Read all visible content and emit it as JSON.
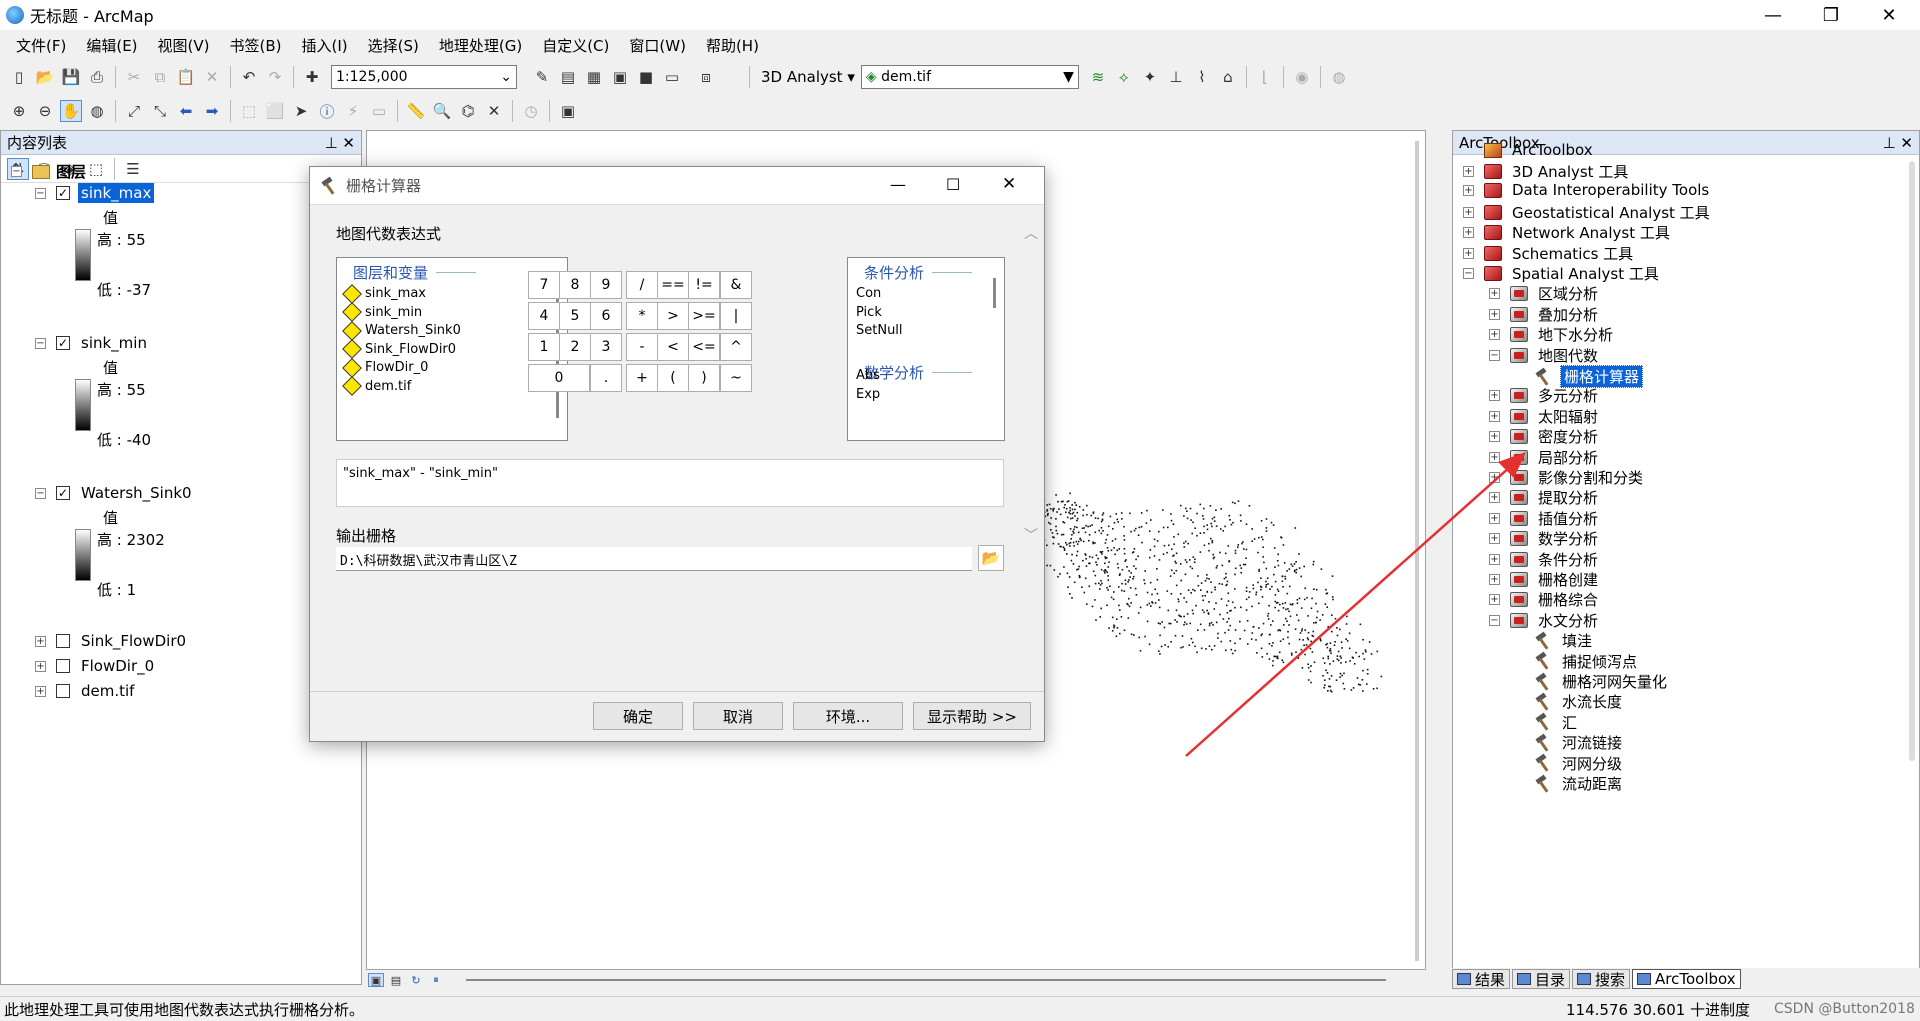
{
  "window": {
    "title": "无标题 - ArcMap"
  },
  "menu": [
    "文件(F)",
    "编辑(E)",
    "视图(V)",
    "书签(B)",
    "插入(I)",
    "选择(S)",
    "地理处理(G)",
    "自定义(C)",
    "窗口(W)",
    "帮助(H)"
  ],
  "toolbar": {
    "scale": "1:125,000",
    "analyst": "3D Analyst",
    "layer": "dem.tif"
  },
  "toc": {
    "title": "内容列表",
    "root": "图层",
    "value_label": "值",
    "layers": [
      {
        "name": "sink_max",
        "checked": true,
        "high": "高 : 55",
        "low": "低 : -37"
      },
      {
        "name": "sink_min",
        "checked": true,
        "high": "高 : 55",
        "low": "低 : -40"
      },
      {
        "name": "Watersh_Sink0",
        "checked": true,
        "high": "高 : 2302",
        "low": "低 : 1"
      },
      {
        "name": "Sink_FlowDir0",
        "checked": false
      },
      {
        "name": "FlowDir_0",
        "checked": false
      },
      {
        "name": "dem.tif",
        "checked": false
      }
    ]
  },
  "toolbox": {
    "title": "ArcToolbox",
    "root": "ArcToolbox",
    "toolsets": [
      "3D Analyst 工具",
      "Data Interoperability Tools",
      "Geostatistical Analyst 工具",
      "Network Analyst 工具",
      "Schematics 工具",
      "Spatial Analyst 工具"
    ],
    "spatial_sets": [
      "区域分析",
      "叠加分析",
      "地下水分析",
      "地图代数"
    ],
    "selected_tool": "栅格计算器",
    "spatial_sets_after": [
      "多元分析",
      "太阳辐射",
      "密度分析",
      "局部分析",
      "影像分割和分类",
      "提取分析",
      "插值分析",
      "数学分析",
      "条件分析",
      "栅格创建",
      "栅格综合",
      "水文分析"
    ],
    "hydro_tools": [
      "填洼",
      "捕捉倾泻点",
      "栅格河网矢量化",
      "水流长度",
      "汇",
      "河流链接",
      "河网分级",
      "流动距离"
    ],
    "tabs": [
      "结果",
      "目录",
      "搜索",
      "ArcToolbox"
    ]
  },
  "dialog": {
    "title": "栅格计算器",
    "section": "地图代数表达式",
    "layers_header": "图层和变量",
    "layers": [
      "sink_max",
      "sink_min",
      "Watersh_Sink0",
      "Sink_FlowDir0",
      "FlowDir_0",
      "dem.tif"
    ],
    "keys": [
      "7",
      "8",
      "9",
      "/",
      "==",
      "!=",
      "&",
      "4",
      "5",
      "6",
      "*",
      ">",
      ">=",
      "|",
      "1",
      "2",
      "3",
      "-",
      "<",
      "<=",
      "^",
      "0",
      ".",
      "+",
      "(",
      ")",
      "~"
    ],
    "cond_header": "条件分析",
    "cond_items": [
      "Con",
      "Pick",
      "SetNull"
    ],
    "math_header": "数学分析",
    "math_items": [
      "Abs",
      "Exp"
    ],
    "expression": "\"sink_max\" - \"sink_min\"",
    "output_label": "输出栅格",
    "output_path": "D:\\科研数据\\武汉市青山区\\Z",
    "buttons": {
      "ok": "确定",
      "cancel": "取消",
      "env": "环境...",
      "help": "显示帮助 >>"
    }
  },
  "status": {
    "message": "此地理处理工具可使用地图代数表达式执行栅格分析。",
    "coords": "114.576  30.601 十进制度",
    "watermark": "CSDN @Button2018"
  },
  "colors": {
    "selection": "#0a64d8",
    "arrow": "#e53030"
  }
}
